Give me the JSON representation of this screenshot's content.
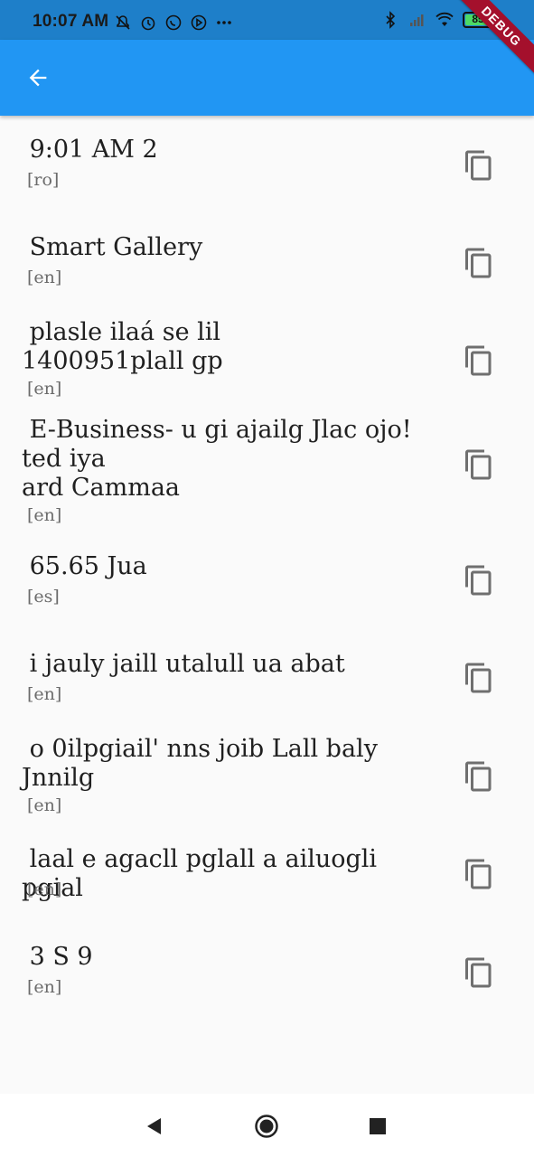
{
  "status_bar": {
    "time": "10:07 AM",
    "notification_icons": [
      "do-not-disturb-icon",
      "alarm-icon",
      "whatsapp-icon",
      "play-icon",
      "more-dots-icon"
    ],
    "battery_level": "85",
    "right_icons": [
      "bluetooth-icon",
      "signal-icon",
      "wifi-icon",
      "battery-icon"
    ]
  },
  "debug_banner": {
    "label": "DEBUG"
  },
  "app_bar": {
    "back_icon": "arrow-back-icon",
    "color": "#2196f3"
  },
  "items": [
    {
      "text": " 9:01 AM 2",
      "lang": "[ro]"
    },
    {
      "text": " Smart Gallery",
      "lang": "[en]"
    },
    {
      "text": " plasle ilaá se lil\n1400951plall gp",
      "lang": "[en]"
    },
    {
      "text": " E-Business- u gi ajailg Jlac ojo!\nted iya\nard Cammaa",
      "lang": "[en]"
    },
    {
      "text": " 65.65 Jua",
      "lang": "[es]"
    },
    {
      "text": " i jauly jaill utalull ua abat",
      "lang": "[en]"
    },
    {
      "text": " o 0ilpgiail' nns joib Lall baly\nJnnilg",
      "lang": "[en]"
    },
    {
      "text": " laal e agacll pglall a ailuogli pgial",
      "lang": "[en]"
    },
    {
      "text": " 3 S 9",
      "lang": "[en]"
    }
  ],
  "item_icon": "copy-icon",
  "nav": {
    "back": "nav-back-icon",
    "home": "nav-home-icon",
    "recents": "nav-recents-icon"
  }
}
